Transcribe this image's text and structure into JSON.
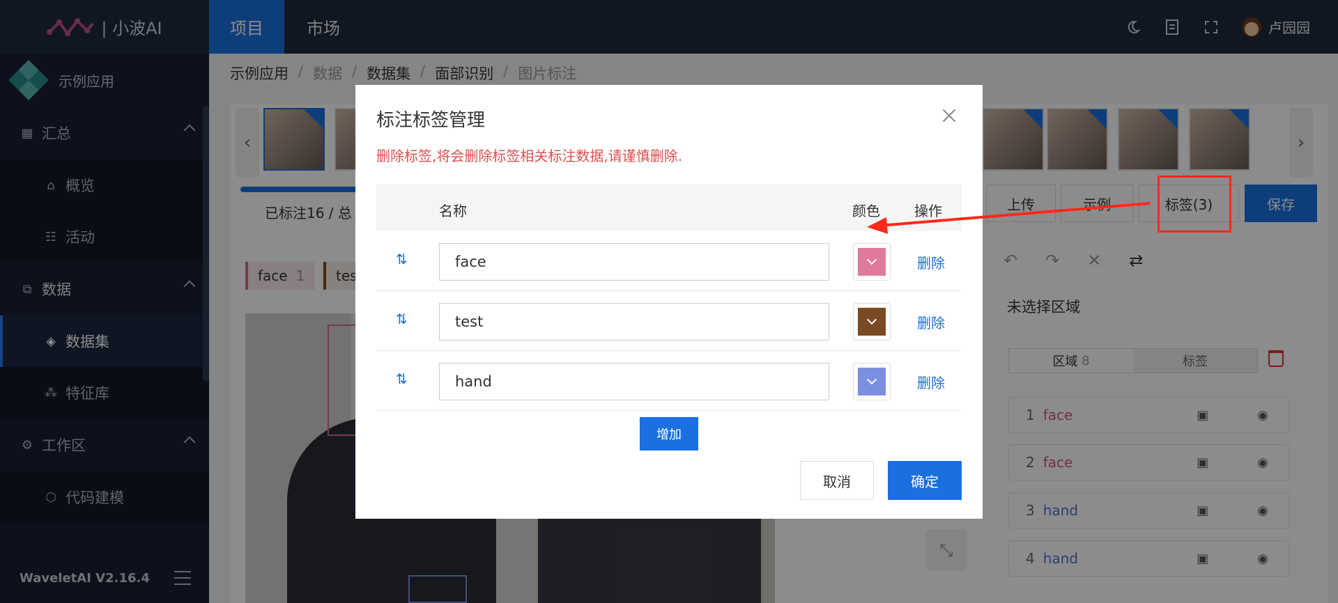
{
  "app": {
    "brand": "| 小波AI",
    "version": "WaveletAI V2.16.4"
  },
  "topnav": {
    "tabs": [
      {
        "label": "项目",
        "active": true
      },
      {
        "label": "市场",
        "active": false
      }
    ],
    "icons": [
      "moon-icon",
      "document-icon",
      "fullscreen-icon"
    ],
    "user": "卢园园"
  },
  "sidebar": {
    "app_name": "示例应用",
    "groups": [
      {
        "label": "汇总",
        "icon": "grid-icon",
        "items": [
          {
            "label": "概览",
            "icon": "home-icon"
          },
          {
            "label": "活动",
            "icon": "activity-icon"
          }
        ]
      },
      {
        "label": "数据",
        "icon": "hierarchy-icon",
        "items": [
          {
            "label": "数据集",
            "icon": "cube-icon",
            "active": true
          },
          {
            "label": "特征库",
            "icon": "molecule-icon"
          }
        ]
      },
      {
        "label": "工作区",
        "icon": "gear-icon",
        "items": [
          {
            "label": "代码建模",
            "icon": "box-icon"
          }
        ]
      }
    ]
  },
  "breadcrumb": [
    "示例应用",
    "数据",
    "数据集",
    "面部识别",
    "图片标注"
  ],
  "progress_text": "已标注16 / 总",
  "toolbar": {
    "upload": "上传",
    "example": "示例",
    "labels": "标签(3)",
    "save": "保存"
  },
  "chips": [
    {
      "label": "face",
      "count": "1"
    },
    {
      "label": "tes",
      "count": ""
    }
  ],
  "right_panel": {
    "unselected": "未选择区域",
    "seg_region": "区域",
    "seg_region_count": "8",
    "seg_label": "标签",
    "regions": [
      {
        "num": "1",
        "label": "face"
      },
      {
        "num": "2",
        "label": "face"
      },
      {
        "num": "3",
        "label": "hand"
      },
      {
        "num": "4",
        "label": "hand"
      }
    ]
  },
  "modal": {
    "title": "标注标签管理",
    "warning": "删除标签,将会删除标签相关标注数据,请谨慎删除.",
    "col_name": "名称",
    "col_color": "颜色",
    "col_action": "操作",
    "rows": [
      {
        "name": "face",
        "color": "#e07a9a",
        "action": "删除"
      },
      {
        "name": "test",
        "color": "#7a4a24",
        "action": "删除"
      },
      {
        "name": "hand",
        "color": "#7b8ee0",
        "action": "删除"
      }
    ],
    "add": "增加",
    "cancel": "取消",
    "ok": "确定"
  },
  "colors": {
    "primary": "#1b6fe0",
    "topbar": "#1f2a3d",
    "sidebar": "#162032",
    "danger": "#e04f4f",
    "annotation": "#ff2a1a"
  }
}
